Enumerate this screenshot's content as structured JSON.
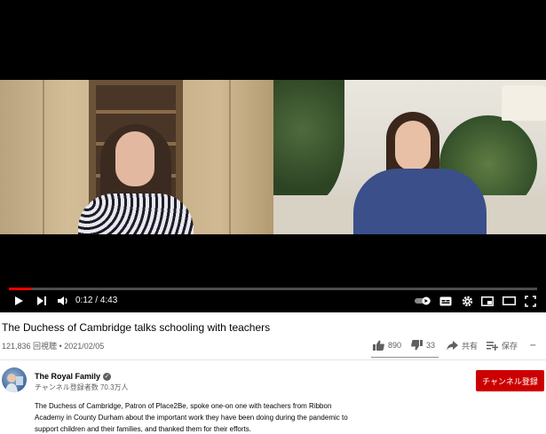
{
  "player": {
    "current_time": "0:12",
    "duration": "4:43",
    "time_separator": " / ",
    "progress_fraction": 0.042
  },
  "video": {
    "title": "The Duchess of Cambridge talks schooling with teachers",
    "views": "121,836 回視聴",
    "meta_separator": " • ",
    "date": "2021/02/05"
  },
  "actions": {
    "likes": "890",
    "dislikes": "33",
    "share_label": "共有",
    "save_label": "保存",
    "more_label": "···"
  },
  "channel": {
    "name": "The Royal Family",
    "subscribers": "チャンネル登録者数 70.3万人",
    "subscribe_label": "チャンネル登録"
  },
  "description": {
    "line1": "The Duchess of Cambridge, Patron of Place2Be, spoke one-on one with teachers from Ribbon",
    "line2": "Academy in County Durham about the important work they have been doing during the pandemic to",
    "line3": "support children and their families, and thanked them for their efforts."
  },
  "icons": {
    "play": "play-icon",
    "next": "next-icon",
    "volume": "volume-icon",
    "autoplay": "autoplay-toggle-icon",
    "captions": "captions-icon",
    "settings": "gear-icon",
    "miniplayer": "miniplayer-icon",
    "theater": "theater-icon",
    "fullscreen": "fullscreen-icon",
    "like": "thumbs-up-icon",
    "dislike": "thumbs-down-icon",
    "share": "share-icon",
    "save": "playlist-add-icon",
    "verified": "verified-check-icon"
  },
  "colors": {
    "progress": "#ff0000",
    "subscribe_bg": "#cc0000"
  }
}
